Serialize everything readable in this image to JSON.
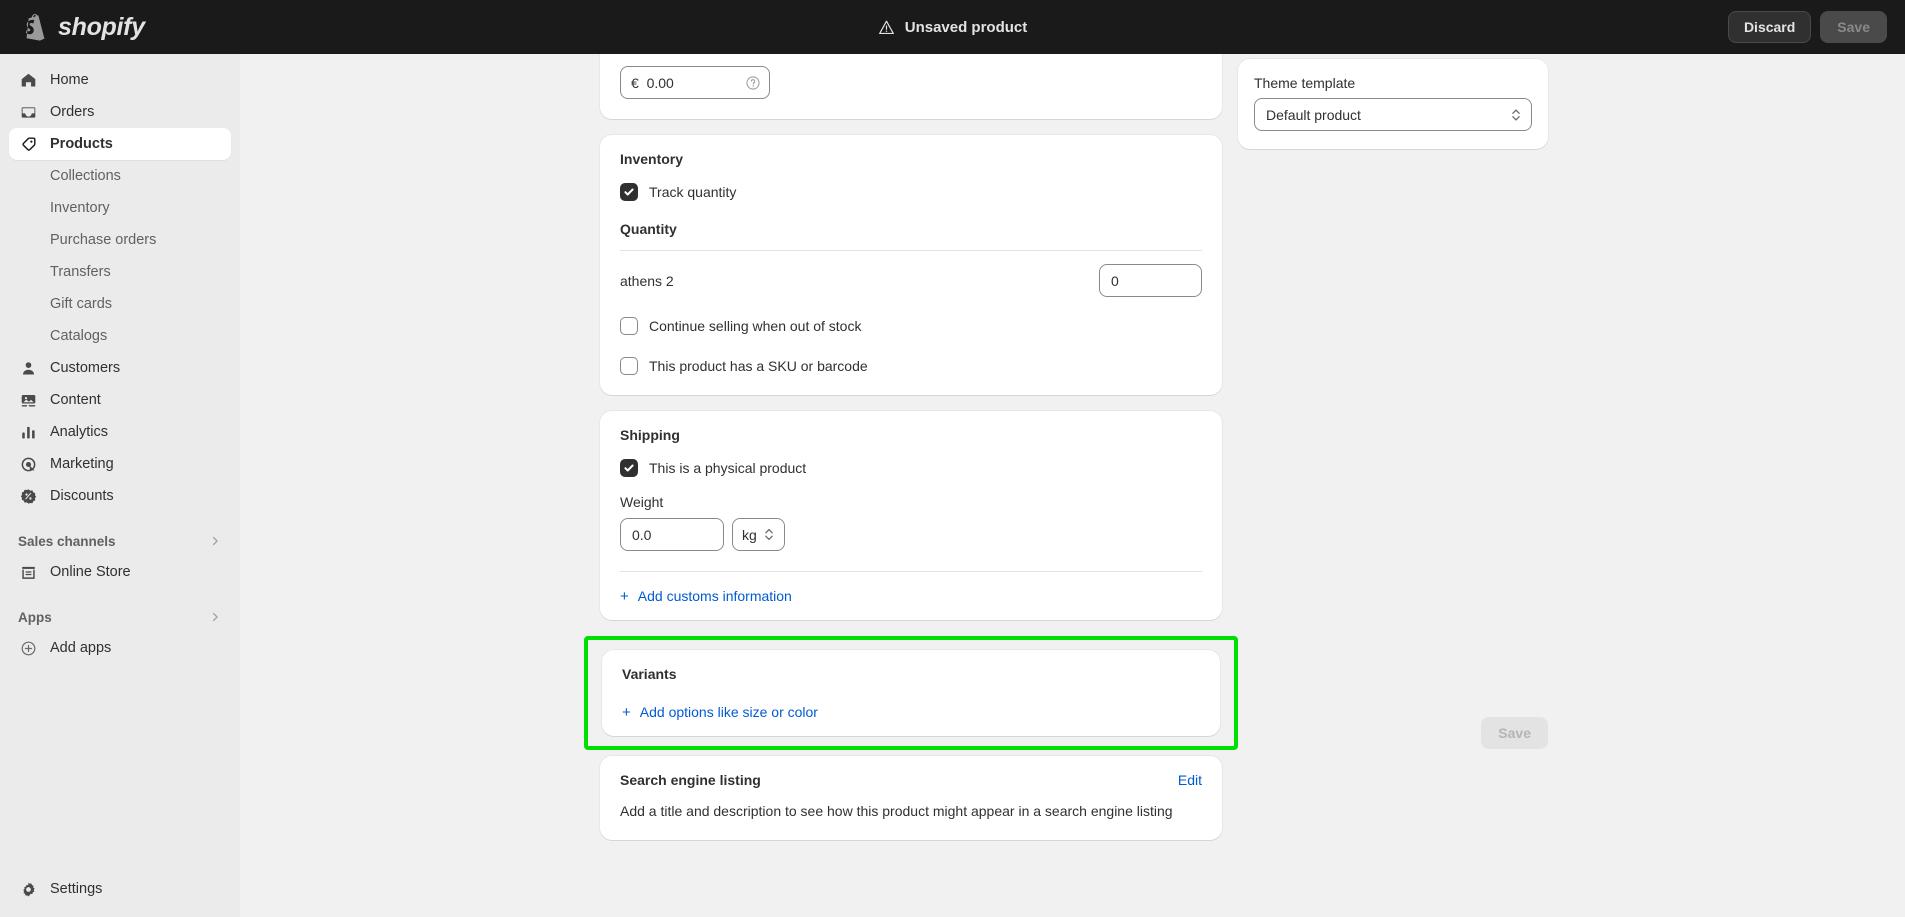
{
  "brand": {
    "name": "shopify",
    "logo_icon": "shopify-bag-icon"
  },
  "topbar": {
    "warning_icon": "warning-triangle-icon",
    "title": "Unsaved product",
    "discard_label": "Discard",
    "save_label": "Save"
  },
  "sidebar": {
    "items": [
      {
        "label": "Home",
        "icon": "home-icon"
      },
      {
        "label": "Orders",
        "icon": "orders-inbox-icon"
      },
      {
        "label": "Products",
        "icon": "products-tag-icon",
        "active": true
      }
    ],
    "product_subitems": [
      {
        "label": "Collections"
      },
      {
        "label": "Inventory"
      },
      {
        "label": "Purchase orders"
      },
      {
        "label": "Transfers"
      },
      {
        "label": "Gift cards"
      },
      {
        "label": "Catalogs"
      }
    ],
    "items2": [
      {
        "label": "Customers",
        "icon": "person-icon"
      },
      {
        "label": "Content",
        "icon": "content-image-icon"
      },
      {
        "label": "Analytics",
        "icon": "analytics-bars-icon"
      },
      {
        "label": "Marketing",
        "icon": "marketing-target-icon"
      },
      {
        "label": "Discounts",
        "icon": "discount-badge-icon"
      }
    ],
    "sales_channels": {
      "label": "Sales channels",
      "chevron_icon": "chevron-right-icon"
    },
    "online_store": {
      "label": "Online Store",
      "icon": "storefront-icon"
    },
    "apps": {
      "label": "Apps",
      "chevron_icon": "chevron-right-icon"
    },
    "add_apps": {
      "label": "Add apps",
      "icon": "plus-circle-icon"
    },
    "settings": {
      "label": "Settings",
      "icon": "gear-icon"
    }
  },
  "pricing": {
    "currency_symbol": "€",
    "price_value": "0.00",
    "help_icon": "question-circle-icon"
  },
  "inventory": {
    "title": "Inventory",
    "track_quantity": {
      "label": "Track quantity",
      "checked": true
    },
    "quantity_label": "Quantity",
    "location_rows": [
      {
        "name": "athens 2",
        "value": "0"
      }
    ],
    "continue_selling": {
      "label": "Continue selling when out of stock",
      "checked": false
    },
    "has_sku": {
      "label": "This product has a SKU or barcode",
      "checked": false
    }
  },
  "shipping": {
    "title": "Shipping",
    "physical_product": {
      "label": "This is a physical product",
      "checked": true
    },
    "weight_label": "Weight",
    "weight_value": "0.0",
    "weight_unit": "kg",
    "unit_chevron_icon": "chevron-updown-icon",
    "add_customs": {
      "label": "Add customs information",
      "icon": "plus-icon"
    }
  },
  "variants": {
    "title": "Variants",
    "add_options": {
      "label": "Add options like size or color",
      "icon": "plus-icon"
    },
    "highlight_color": "#00e000"
  },
  "search_engine_listing": {
    "title": "Search engine listing",
    "edit_label": "Edit",
    "description": "Add a title and description to see how this product might appear in a search engine listing"
  },
  "theme_template": {
    "label": "Theme template",
    "selected": "Default product",
    "chevron_icon": "chevron-updown-icon"
  },
  "footer": {
    "save_label": "Save"
  },
  "colors": {
    "topbar_bg": "#1a1a1a",
    "sidebar_bg": "#ebebeb",
    "page_bg": "#f1f1f1",
    "link": "#005bd3",
    "text": "#303030",
    "muted": "#616161"
  }
}
